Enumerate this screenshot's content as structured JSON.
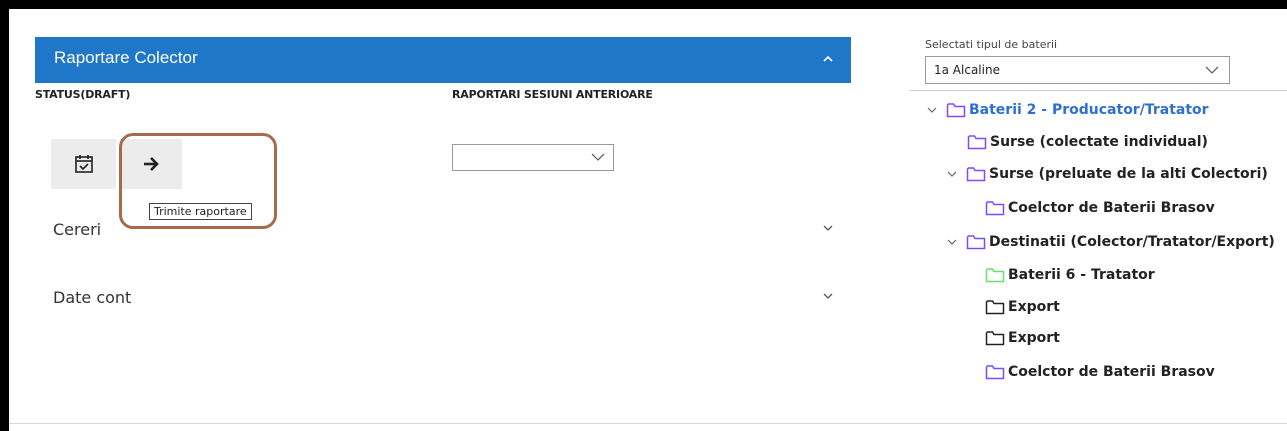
{
  "panel": {
    "title": "Raportare Colector"
  },
  "columns": {
    "status_label": "STATUS(DRAFT)",
    "previous_label": "RAPORTARI SESIUNI ANTERIOARE"
  },
  "actions": {
    "send_tooltip": "Trimite raportare"
  },
  "previous_sessions": {
    "selected": ""
  },
  "accordions": [
    {
      "label": "Cereri"
    },
    {
      "label": "Date cont"
    }
  ],
  "battery_type": {
    "label": "Selectati tipul de baterii",
    "selected": "1a Alcaline"
  },
  "tree": [
    {
      "label": "Baterii 2 - Producator/Tratator",
      "folder_color": "#7b4cff",
      "expanded": true
    },
    {
      "label": "Surse (colectate individual)",
      "folder_color": "#7b4cff"
    },
    {
      "label": "Surse (preluate de la alti Colectori)",
      "folder_color": "#7b4cff",
      "expanded": true
    },
    {
      "label": "Coelctor de Baterii Brasov",
      "folder_color": "#7b4cff"
    },
    {
      "label": "Destinatii (Colector/Tratator/Export)",
      "folder_color": "#7b4cff",
      "expanded": true
    },
    {
      "label": "Baterii 6 - Tratator",
      "folder_color": "#6fdc6f"
    },
    {
      "label": "Export",
      "folder_color": "#222222"
    },
    {
      "label": "Export",
      "folder_color": "#222222"
    },
    {
      "label": "Coelctor de Baterii Brasov",
      "folder_color": "#7b4cff"
    }
  ],
  "colors": {
    "header": "#1f77c9",
    "root_text": "#2e6fd0",
    "highlight": "#a56b4b"
  }
}
